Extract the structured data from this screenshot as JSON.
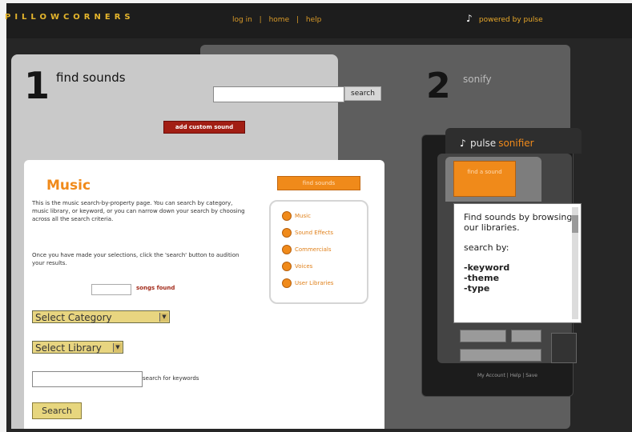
{
  "header": {
    "logo_text": "PILLOWCORNERS",
    "nav_login": "log in",
    "nav_home": "home",
    "nav_help": "help",
    "separator": "|",
    "powered_by": "powered by pulse"
  },
  "step1": {
    "number": "1",
    "label": "find sounds",
    "search_placeholder": "",
    "search_button": "search",
    "custom_sound_button": "add custom sound"
  },
  "step2": {
    "number": "2",
    "label": "sonify"
  },
  "music": {
    "title": "Music",
    "description": "This is the music search-by-property page. You can search by category, music library, or keyword, or you can narrow down your search by choosing across all the search criteria.",
    "description2": "Once you have made your selections, click the 'search' button to audition your results.",
    "songs_count": "",
    "songs_found_label": "songs found",
    "category_select": "Select Category",
    "library_select": "Select Library",
    "keywords_placeholder": "",
    "keywords_label": "search for keywords",
    "search_button": "Search",
    "find_sounds_tab": "find sounds",
    "categories": [
      "Music",
      "Sound Effects",
      "Commercials",
      "Voices",
      "User Libraries"
    ]
  },
  "widget": {
    "brand": "pulse",
    "brand_accent": "sonifier",
    "tab_label": "find a sound",
    "text_line1": "Find sounds by browsing our libraries.",
    "text_search_by": "search by:",
    "opt1": "-keyword",
    "opt2": "-theme",
    "opt3": "-type",
    "footer_links": "My Account | Help | Save"
  },
  "colors": {
    "accent_orange": "#f08a1a",
    "dark_red": "#a21e14",
    "select_yellow": "#e8d580"
  }
}
